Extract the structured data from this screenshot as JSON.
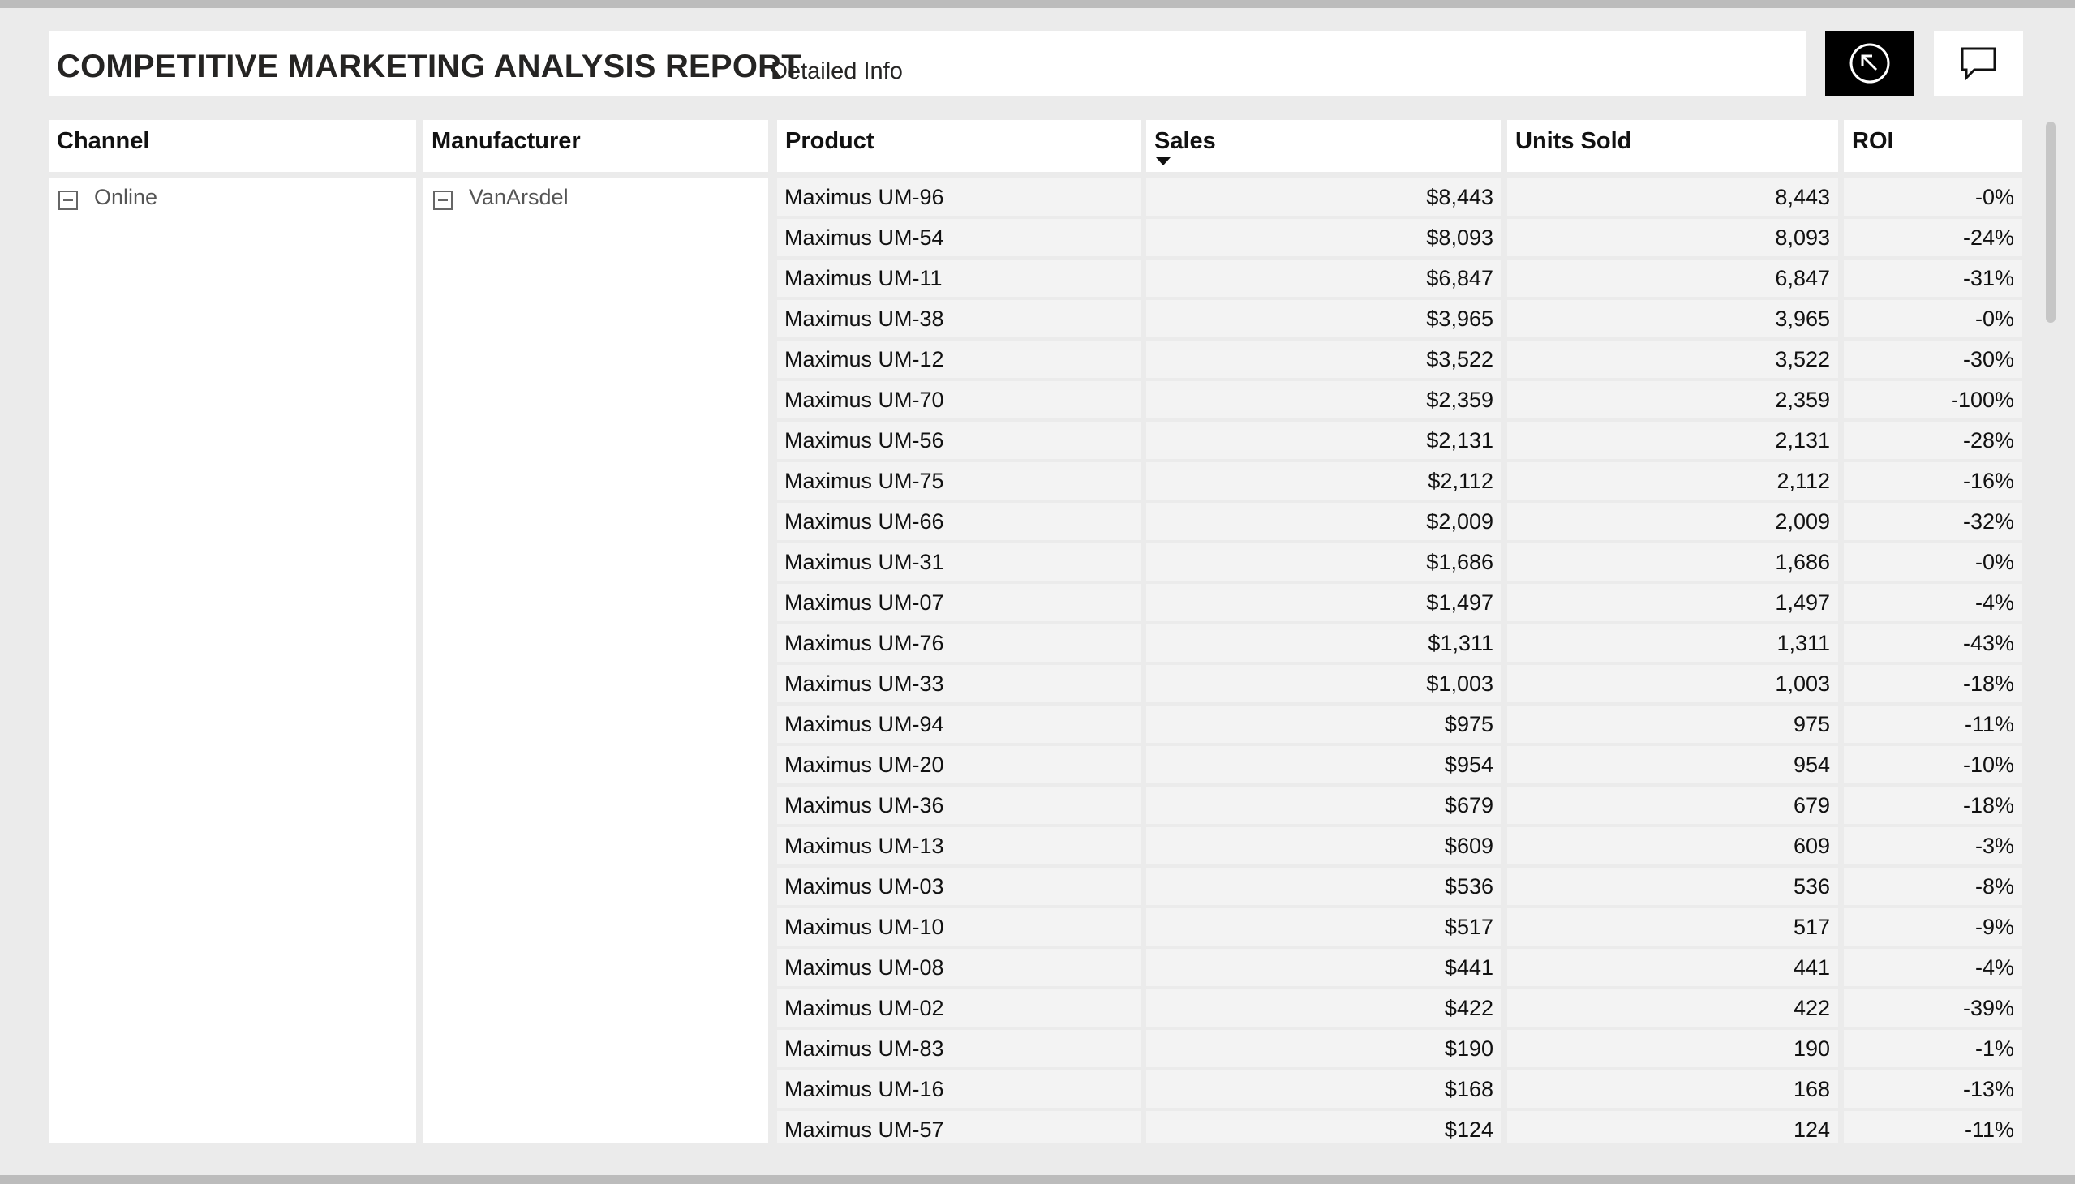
{
  "header": {
    "title": "COMPETITIVE MARKETING ANALYSIS REPORT",
    "subtitle": "Detailed Info"
  },
  "buttons": {
    "back_icon": "back-arrow-circle-icon",
    "comment_icon": "comment-icon"
  },
  "table": {
    "columns": [
      "Channel",
      "Manufacturer",
      "Product",
      "Sales",
      "Units Sold",
      "ROI"
    ],
    "sort_column": "Sales",
    "sort_direction": "descending",
    "channel": "Online",
    "manufacturer": "VanArsdel",
    "rows": [
      {
        "product": "Maximus UM-96",
        "sales": "$8,443",
        "units": "8,443",
        "roi": "-0%"
      },
      {
        "product": "Maximus UM-54",
        "sales": "$8,093",
        "units": "8,093",
        "roi": "-24%"
      },
      {
        "product": "Maximus UM-11",
        "sales": "$6,847",
        "units": "6,847",
        "roi": "-31%"
      },
      {
        "product": "Maximus UM-38",
        "sales": "$3,965",
        "units": "3,965",
        "roi": "-0%"
      },
      {
        "product": "Maximus UM-12",
        "sales": "$3,522",
        "units": "3,522",
        "roi": "-30%"
      },
      {
        "product": "Maximus UM-70",
        "sales": "$2,359",
        "units": "2,359",
        "roi": "-100%"
      },
      {
        "product": "Maximus UM-56",
        "sales": "$2,131",
        "units": "2,131",
        "roi": "-28%"
      },
      {
        "product": "Maximus UM-75",
        "sales": "$2,112",
        "units": "2,112",
        "roi": "-16%"
      },
      {
        "product": "Maximus UM-66",
        "sales": "$2,009",
        "units": "2,009",
        "roi": "-32%"
      },
      {
        "product": "Maximus UM-31",
        "sales": "$1,686",
        "units": "1,686",
        "roi": "-0%"
      },
      {
        "product": "Maximus UM-07",
        "sales": "$1,497",
        "units": "1,497",
        "roi": "-4%"
      },
      {
        "product": "Maximus UM-76",
        "sales": "$1,311",
        "units": "1,311",
        "roi": "-43%"
      },
      {
        "product": "Maximus UM-33",
        "sales": "$1,003",
        "units": "1,003",
        "roi": "-18%"
      },
      {
        "product": "Maximus UM-94",
        "sales": "$975",
        "units": "975",
        "roi": "-11%"
      },
      {
        "product": "Maximus UM-20",
        "sales": "$954",
        "units": "954",
        "roi": "-10%"
      },
      {
        "product": "Maximus UM-36",
        "sales": "$679",
        "units": "679",
        "roi": "-18%"
      },
      {
        "product": "Maximus UM-13",
        "sales": "$609",
        "units": "609",
        "roi": "-3%"
      },
      {
        "product": "Maximus UM-03",
        "sales": "$536",
        "units": "536",
        "roi": "-8%"
      },
      {
        "product": "Maximus UM-10",
        "sales": "$517",
        "units": "517",
        "roi": "-9%"
      },
      {
        "product": "Maximus UM-08",
        "sales": "$441",
        "units": "441",
        "roi": "-4%"
      },
      {
        "product": "Maximus UM-02",
        "sales": "$422",
        "units": "422",
        "roi": "-39%"
      },
      {
        "product": "Maximus UM-83",
        "sales": "$190",
        "units": "190",
        "roi": "-1%"
      },
      {
        "product": "Maximus UM-16",
        "sales": "$168",
        "units": "168",
        "roi": "-13%"
      },
      {
        "product": "Maximus UM-57",
        "sales": "$124",
        "units": "124",
        "roi": "-11%"
      }
    ]
  }
}
